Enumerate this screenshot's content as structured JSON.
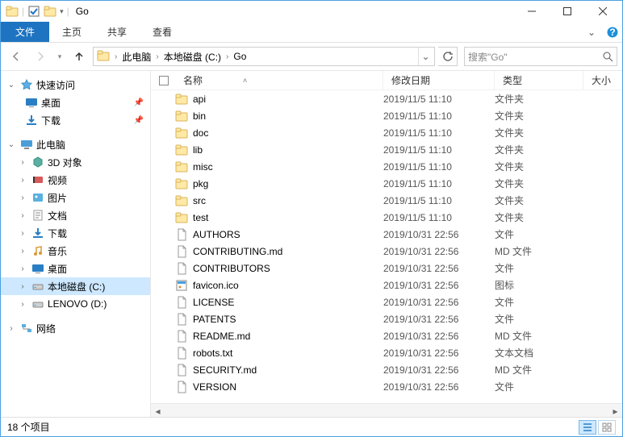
{
  "title": "Go",
  "ribbon": {
    "file": "文件",
    "home": "主页",
    "share": "共享",
    "view": "查看"
  },
  "breadcrumb": [
    "此电脑",
    "本地磁盘 (C:)",
    "Go"
  ],
  "search_placeholder": "搜索\"Go\"",
  "columns": {
    "name": "名称",
    "date": "修改日期",
    "type": "类型",
    "size": "大小"
  },
  "sidebar": {
    "quick_access": "快速访问",
    "desktop": "桌面",
    "downloads": "下载",
    "this_pc": "此电脑",
    "objects3d": "3D 对象",
    "videos": "视频",
    "pictures": "图片",
    "documents": "文档",
    "downloads2": "下载",
    "music": "音乐",
    "desktop2": "桌面",
    "local_c": "本地磁盘 (C:)",
    "lenovo_d": "LENOVO (D:)",
    "network": "网络"
  },
  "items": [
    {
      "name": "api",
      "date": "2019/11/5 11:10",
      "type": "文件夹",
      "icon": "folder"
    },
    {
      "name": "bin",
      "date": "2019/11/5 11:10",
      "type": "文件夹",
      "icon": "folder"
    },
    {
      "name": "doc",
      "date": "2019/11/5 11:10",
      "type": "文件夹",
      "icon": "folder"
    },
    {
      "name": "lib",
      "date": "2019/11/5 11:10",
      "type": "文件夹",
      "icon": "folder"
    },
    {
      "name": "misc",
      "date": "2019/11/5 11:10",
      "type": "文件夹",
      "icon": "folder"
    },
    {
      "name": "pkg",
      "date": "2019/11/5 11:10",
      "type": "文件夹",
      "icon": "folder"
    },
    {
      "name": "src",
      "date": "2019/11/5 11:10",
      "type": "文件夹",
      "icon": "folder"
    },
    {
      "name": "test",
      "date": "2019/11/5 11:10",
      "type": "文件夹",
      "icon": "folder"
    },
    {
      "name": "AUTHORS",
      "date": "2019/10/31 22:56",
      "type": "文件",
      "icon": "file"
    },
    {
      "name": "CONTRIBUTING.md",
      "date": "2019/10/31 22:56",
      "type": "MD 文件",
      "icon": "file"
    },
    {
      "name": "CONTRIBUTORS",
      "date": "2019/10/31 22:56",
      "type": "文件",
      "icon": "file"
    },
    {
      "name": "favicon.ico",
      "date": "2019/10/31 22:56",
      "type": "图标",
      "icon": "ico"
    },
    {
      "name": "LICENSE",
      "date": "2019/10/31 22:56",
      "type": "文件",
      "icon": "file"
    },
    {
      "name": "PATENTS",
      "date": "2019/10/31 22:56",
      "type": "文件",
      "icon": "file"
    },
    {
      "name": "README.md",
      "date": "2019/10/31 22:56",
      "type": "MD 文件",
      "icon": "file"
    },
    {
      "name": "robots.txt",
      "date": "2019/10/31 22:56",
      "type": "文本文档",
      "icon": "file"
    },
    {
      "name": "SECURITY.md",
      "date": "2019/10/31 22:56",
      "type": "MD 文件",
      "icon": "file"
    },
    {
      "name": "VERSION",
      "date": "2019/10/31 22:56",
      "type": "文件",
      "icon": "file"
    }
  ],
  "status_text": "18 个项目"
}
